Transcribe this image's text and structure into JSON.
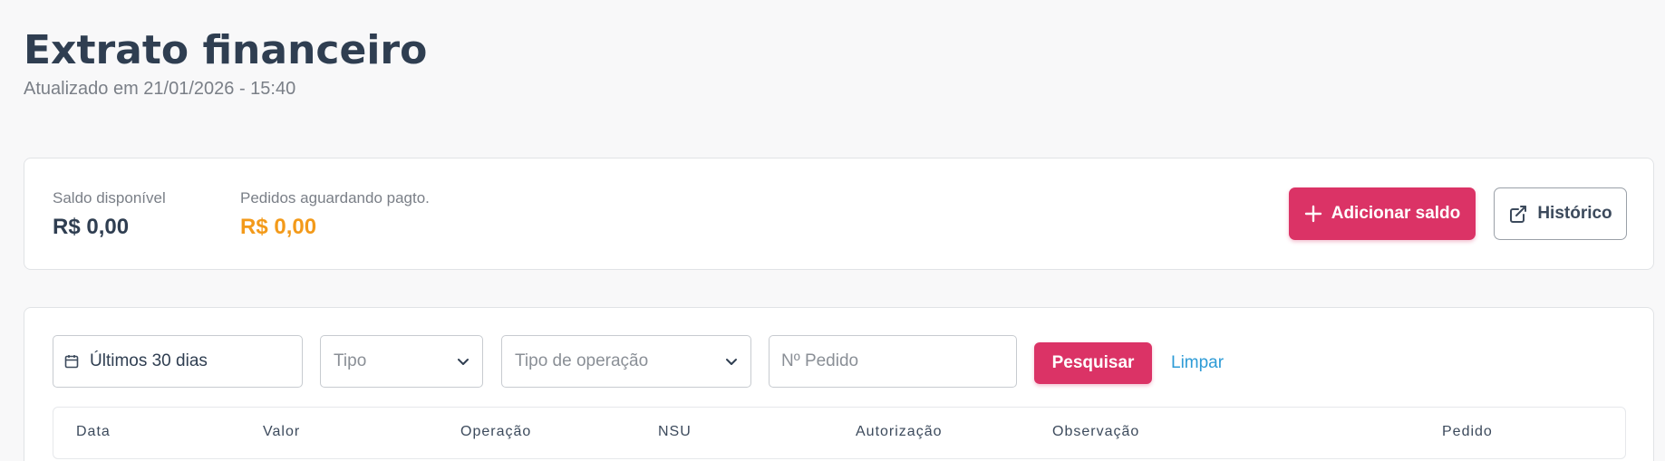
{
  "header": {
    "title": "Extrato financeiro",
    "updated": "Atualizado em 21/01/2026 - 15:40"
  },
  "balance": {
    "available_label": "Saldo disponível",
    "available_value": "R$ 0,00",
    "pending_label": "Pedidos aguardando pagto.",
    "pending_value": "R$ 0,00",
    "add_button_label": "Adicionar saldo",
    "history_button_label": "Histórico"
  },
  "filters": {
    "date_range": "Últimos 30 dias",
    "tipo_placeholder": "Tipo",
    "operation_type_placeholder": "Tipo de operação",
    "order_number_placeholder": "Nº Pedido",
    "search_label": "Pesquisar",
    "clear_label": "Limpar"
  },
  "table": {
    "columns": [
      "Data",
      "Valor",
      "Operação",
      "NSU",
      "Autorização",
      "Observação",
      "Pedido"
    ]
  },
  "colors": {
    "primary": "#db3366",
    "pending": "#f39a1a",
    "link": "#2d9bd6",
    "text": "#2f3e51"
  },
  "icons": {
    "add": "plus-icon",
    "history": "external-link-icon",
    "date": "calendar-icon",
    "select": "chevron-down-icon"
  }
}
